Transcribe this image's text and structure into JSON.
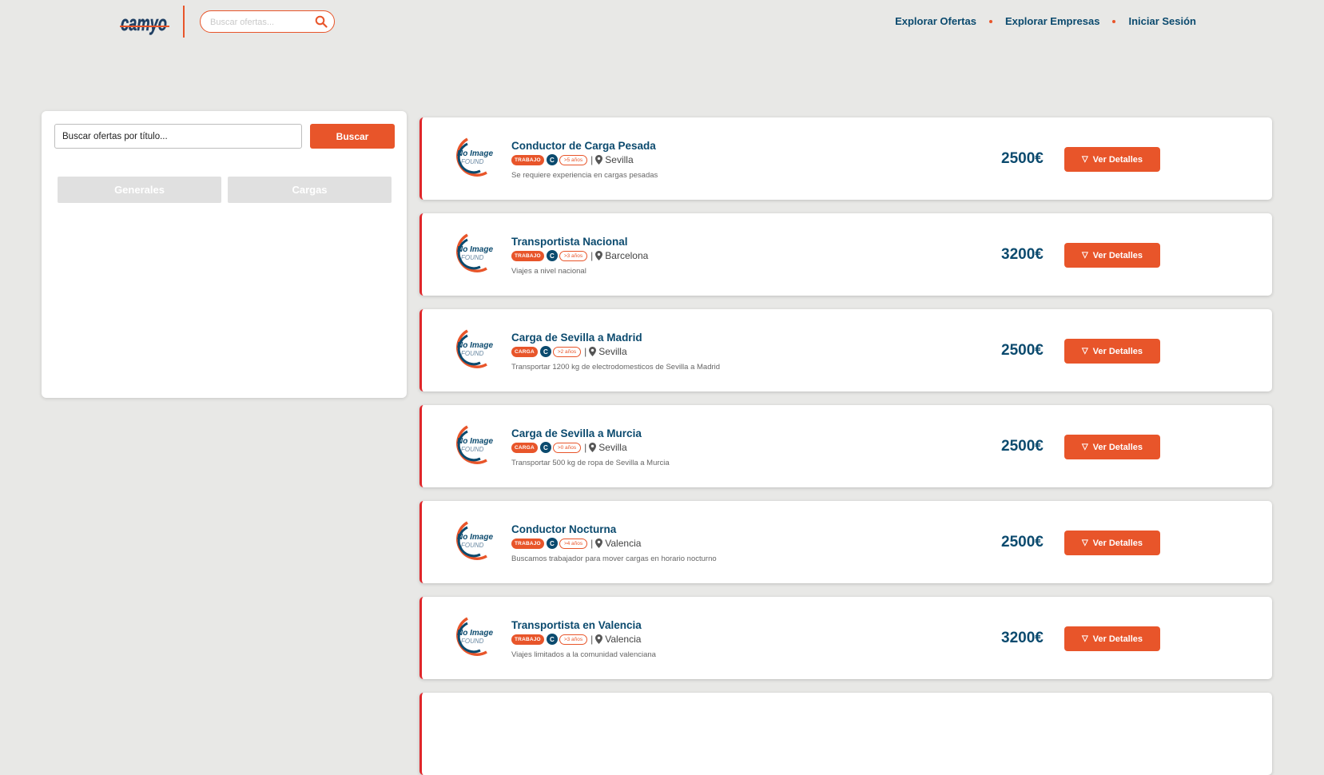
{
  "header": {
    "logo_text": "camyo",
    "search_placeholder": "Buscar ofertas...",
    "nav": [
      "Explorar Ofertas",
      "Explorar Empresas",
      "Iniciar Sesión"
    ]
  },
  "sidebar": {
    "search_placeholder": "Buscar ofertas por título...",
    "search_button": "Buscar",
    "tabs": [
      "Generales",
      "Cargas"
    ]
  },
  "offers": [
    {
      "title": "Conductor de Carga Pesada",
      "type": "TRABAJO",
      "license": "C",
      "experience": ">5 años",
      "city": "Sevilla",
      "description": "Se requiere experiencia en cargas pesadas",
      "price": "2500€",
      "button": "Ver Detalles",
      "image_text": [
        "No Image",
        "FOUND"
      ]
    },
    {
      "title": "Transportista Nacional",
      "type": "TRABAJO",
      "license": "C",
      "experience": ">3 años",
      "city": "Barcelona",
      "description": "Viajes a nivel nacional",
      "price": "3200€",
      "button": "Ver Detalles",
      "image_text": [
        "No Image",
        "FOUND"
      ]
    },
    {
      "title": "Carga de Sevilla a Madrid",
      "type": "CARGA",
      "license": "C",
      "experience": ">2 años",
      "city": "Sevilla",
      "description": "Transportar 1200 kg de electrodomesticos de Sevilla a Madrid",
      "price": "2500€",
      "button": "Ver Detalles",
      "image_text": [
        "No Image",
        "FOUND"
      ]
    },
    {
      "title": "Carga de Sevilla a Murcia",
      "type": "CARGA",
      "license": "C",
      "experience": ">0 años",
      "city": "Sevilla",
      "description": "Transportar 500 kg de ropa de Sevilla a Murcia",
      "price": "2500€",
      "button": "Ver Detalles",
      "image_text": [
        "No Image",
        "FOUND"
      ]
    },
    {
      "title": "Conductor Nocturna",
      "type": "TRABAJO",
      "license": "C",
      "experience": ">4 años",
      "city": "Valencia",
      "description": "Buscamos trabajador para mover cargas en horario nocturno",
      "price": "2500€",
      "button": "Ver Detalles",
      "image_text": [
        "No Image",
        "FOUND"
      ]
    },
    {
      "title": "Transportista en Valencia",
      "type": "TRABAJO",
      "license": "C",
      "experience": ">3 años",
      "city": "Valencia",
      "description": "Viajes limitados a la comunidad valenciana",
      "price": "3200€",
      "button": "Ver Detalles",
      "image_text": [
        "No Image",
        "FOUND"
      ]
    }
  ],
  "colors": {
    "accent": "#e8552a",
    "primary": "#0b4a6e",
    "card_border": "#e0262a",
    "background": "#e8e8e6"
  }
}
